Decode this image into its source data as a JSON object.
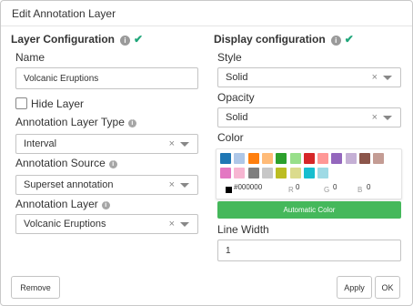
{
  "dialog": {
    "title": "Edit Annotation Layer"
  },
  "layer_config": {
    "heading": "Layer Configuration",
    "name_label": "Name",
    "name_value": "Volcanic Eruptions",
    "hide_layer_label": "Hide Layer",
    "hide_layer_checked": false,
    "type_label": "Annotation Layer Type",
    "type_value": "Interval",
    "source_label": "Annotation Source",
    "source_value": "Superset annotation",
    "layer_label": "Annotation Layer",
    "layer_value": "Volcanic Eruptions"
  },
  "display_config": {
    "heading": "Display configuration",
    "style_label": "Style",
    "style_value": "Solid",
    "opacity_label": "Opacity",
    "opacity_value": "Solid",
    "color_label": "Color",
    "swatches": [
      "#1f77b4",
      "#aec7e8",
      "#ff7f0e",
      "#ffbb78",
      "#2ca02c",
      "#98df8a",
      "#d62728",
      "#ff9896",
      "#9467bd",
      "#c5b0d5",
      "#8c564b",
      "#c49c94",
      "#e377c2",
      "#f7b6d2",
      "#7f7f7f",
      "#c7c7c7",
      "#bcbd22",
      "#dbdb8d",
      "#17becf",
      "#9edae5"
    ],
    "hex_value": "#000000",
    "r_label": "R",
    "r_value": "0",
    "g_label": "G",
    "g_value": "0",
    "b_label": "B",
    "b_value": "0",
    "auto_color_label": "Automatic Color",
    "line_width_label": "Line Width",
    "line_width_value": "1"
  },
  "icons": {
    "clear": "×",
    "info": "i",
    "check": "✔"
  },
  "footer": {
    "remove_label": "Remove",
    "apply_label": "Apply",
    "ok_label": "OK"
  },
  "colors": {
    "accent_green": "#45b85b",
    "check_green": "#1fa67a"
  }
}
